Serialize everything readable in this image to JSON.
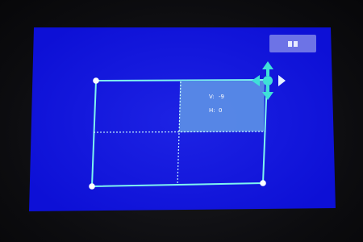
{
  "colors": {
    "screen": "#0d10d6",
    "frame": "#7ff4f0",
    "highlight": "#5b8fe6",
    "button": "#6d73e6",
    "handle": "#3fe0d8"
  },
  "toolbar": {
    "pause_icon": "pause-icon"
  },
  "readout": {
    "v_label": "V:",
    "v_value": "-9",
    "h_label": "H:",
    "h_value": "0"
  },
  "handle": {
    "icon": "move-arrows-icon"
  }
}
